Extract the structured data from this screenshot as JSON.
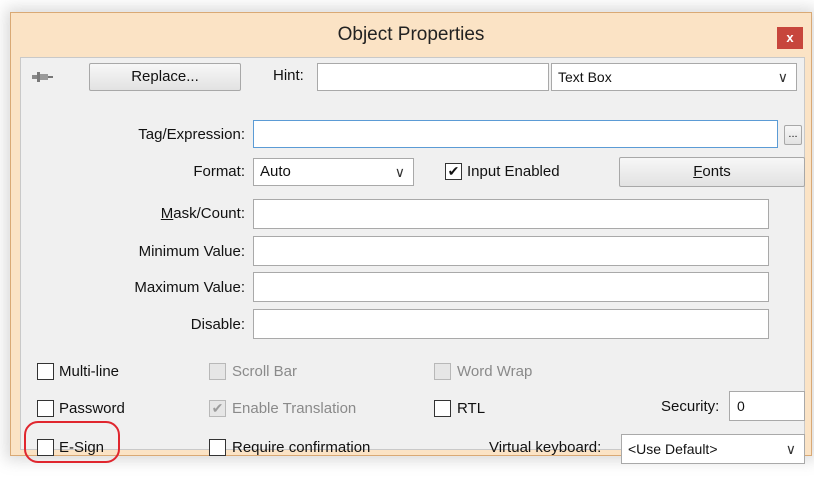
{
  "window": {
    "title": "Object Properties",
    "close_glyph": "x"
  },
  "toolbar": {
    "pin_icon": "pushpin-icon",
    "replace_label": "Replace...",
    "hint_label": "Hint:",
    "hint_value": "",
    "object_type": "Text Box"
  },
  "fields": {
    "tag_label": "Tag/Expression:",
    "tag_value": "",
    "browse_label": "...",
    "format_label": "Format:",
    "format_value": "Auto",
    "input_enabled_label": "Input Enabled",
    "input_enabled_checked": true,
    "fonts_label_first": "F",
    "fonts_label_rest": "onts",
    "mask_label_first": "M",
    "mask_label_rest": "ask/Count:",
    "mask_value": "",
    "min_label": "Minimum Value:",
    "min_value": "",
    "max_label": "Maximum Value:",
    "max_value": "",
    "disable_label": "Disable:",
    "disable_value": ""
  },
  "options": {
    "multiline": "Multi-line",
    "scroll_bar": "Scroll Bar",
    "word_wrap": "Word Wrap",
    "password": "Password",
    "enable_translation": "Enable Translation",
    "rtl": "RTL",
    "security_label": "Security:",
    "security_value": "0",
    "esign": "E-Sign",
    "require_confirmation": "Require confirmation",
    "virtual_keyboard_label": "Virtual keyboard:",
    "virtual_keyboard_value": "<Use Default>"
  },
  "glyphs": {
    "check": "✔",
    "chevron": "∨"
  },
  "colors": {
    "title_bar": "#fbe3c5",
    "close_button": "#c7463c",
    "highlight": "#e0262e"
  }
}
